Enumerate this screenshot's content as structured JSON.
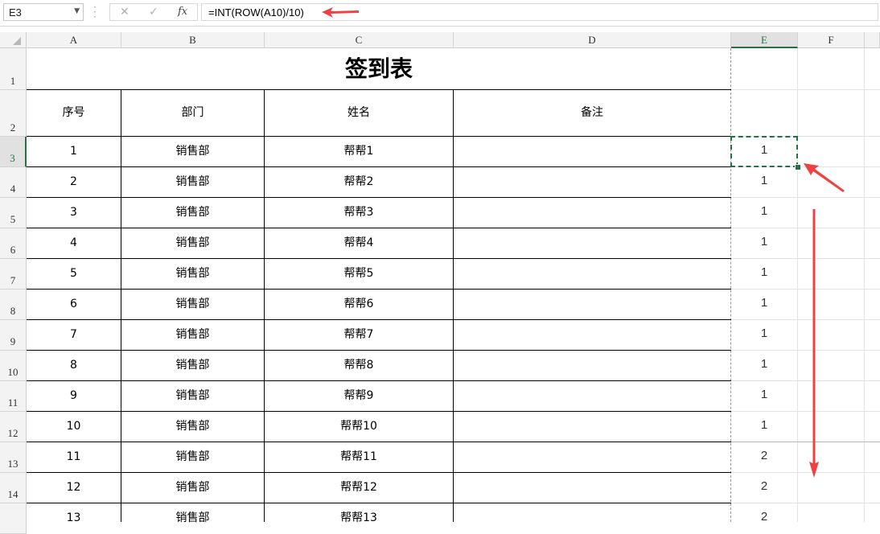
{
  "namebox": {
    "value": "E3"
  },
  "formula_bar": {
    "formula": "=INT(ROW(A10)/10)",
    "cancel_glyph": "✕",
    "enter_glyph": "✓",
    "fx_label": "fx"
  },
  "columns": [
    "A",
    "B",
    "C",
    "D",
    "E",
    "F"
  ],
  "rows": [
    "1",
    "2",
    "3",
    "4",
    "5",
    "6",
    "7",
    "8",
    "9",
    "10",
    "11",
    "12",
    "13",
    "14"
  ],
  "title": "签到表",
  "headers": {
    "seq": "序号",
    "dept": "部门",
    "name": "姓名",
    "note": "备注"
  },
  "data_rows": [
    {
      "seq": "1",
      "dept": "销售部",
      "name": "帮帮1",
      "e": "1"
    },
    {
      "seq": "2",
      "dept": "销售部",
      "name": "帮帮2",
      "e": "1"
    },
    {
      "seq": "3",
      "dept": "销售部",
      "name": "帮帮3",
      "e": "1"
    },
    {
      "seq": "4",
      "dept": "销售部",
      "name": "帮帮4",
      "e": "1"
    },
    {
      "seq": "5",
      "dept": "销售部",
      "name": "帮帮5",
      "e": "1"
    },
    {
      "seq": "6",
      "dept": "销售部",
      "name": "帮帮6",
      "e": "1"
    },
    {
      "seq": "7",
      "dept": "销售部",
      "name": "帮帮7",
      "e": "1"
    },
    {
      "seq": "8",
      "dept": "销售部",
      "name": "帮帮8",
      "e": "1"
    },
    {
      "seq": "9",
      "dept": "销售部",
      "name": "帮帮9",
      "e": "1"
    },
    {
      "seq": "10",
      "dept": "销售部",
      "name": "帮帮10",
      "e": "1"
    },
    {
      "seq": "11",
      "dept": "销售部",
      "name": "帮帮11",
      "e": "2"
    },
    {
      "seq": "12",
      "dept": "销售部",
      "name": "帮帮12",
      "e": "2"
    },
    {
      "seq": "13",
      "dept": "销售部",
      "name": "帮帮13",
      "e": "2"
    }
  ],
  "colors": {
    "selection": "#217346",
    "annotation_arrow": "#f04040"
  },
  "icons": {
    "arrow": "annotation-arrow-icon"
  }
}
